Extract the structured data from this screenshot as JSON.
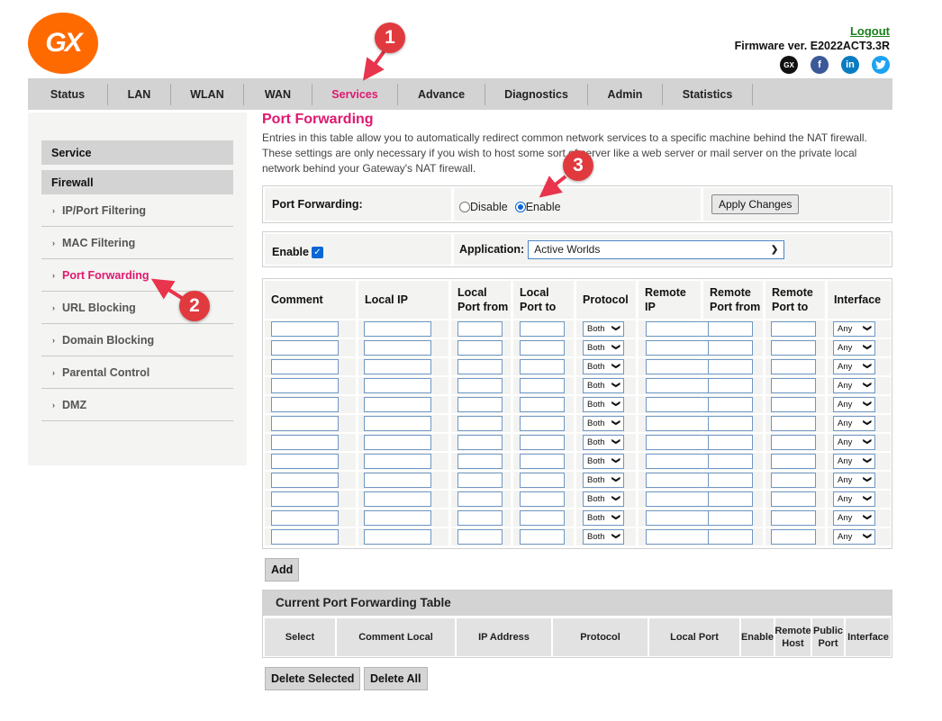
{
  "header": {
    "logo_text": "GX",
    "logout_label": "Logout",
    "firmware": "Firmware ver. E2022ACT3.3R",
    "social": [
      {
        "name": "gx-social-icon",
        "glyph": "GX"
      },
      {
        "name": "facebook-icon",
        "glyph": "f"
      },
      {
        "name": "linkedin-icon",
        "glyph": "in"
      },
      {
        "name": "twitter-icon",
        "glyph": "🐦"
      }
    ]
  },
  "nav": {
    "items": [
      {
        "label": "Status"
      },
      {
        "label": "LAN"
      },
      {
        "label": "WLAN"
      },
      {
        "label": "WAN"
      },
      {
        "label": "Services",
        "active": true
      },
      {
        "label": "Advance"
      },
      {
        "label": "Diagnostics"
      },
      {
        "label": "Admin"
      },
      {
        "label": "Statistics"
      }
    ]
  },
  "sidebar": {
    "sections": [
      "Service",
      "Firewall"
    ],
    "items": [
      {
        "label": "IP/Port Filtering"
      },
      {
        "label": "MAC Filtering"
      },
      {
        "label": "Port Forwarding",
        "active": true
      },
      {
        "label": "URL Blocking"
      },
      {
        "label": "Domain Blocking"
      },
      {
        "label": "Parental Control"
      },
      {
        "label": "DMZ"
      }
    ]
  },
  "main": {
    "title": "Port Forwarding",
    "description": "Entries in this table allow you to automatically redirect common network services to a specific machine behind the NAT firewall. These settings are only necessary if you wish to host some sort of server like a web server or mail server on the private local network behind your Gateway's NAT firewall.",
    "port_forwarding_label": "Port Forwarding:",
    "disable_label": "Disable",
    "enable_label": "Enable",
    "port_forwarding_state": "Enable",
    "apply_label": "Apply Changes",
    "enable_checkbox_label": "Enable",
    "enable_checked": true,
    "application_label": "Application:",
    "application_value": "Active Worlds"
  },
  "rules_table": {
    "headers": [
      "Comment",
      "Local IP",
      "Local\nPort from",
      "Local\nPort to",
      "Protocol",
      "Remote\nIP",
      "Remote\nPort from",
      "Remote\nPort to",
      "Interface"
    ],
    "row_count": 12,
    "protocol_default": "Both",
    "interface_default": "Any"
  },
  "add_label": "Add",
  "current_table": {
    "title": "Current Port Forwarding Table",
    "headers": [
      "Select",
      "Comment Local",
      "IP Address",
      "Protocol",
      "Local Port",
      "Enable",
      "Remote Host",
      "Public Port",
      "Interface"
    ]
  },
  "delete_selected_label": "Delete Selected",
  "delete_all_label": "Delete All",
  "annotations": [
    "1",
    "2",
    "3"
  ],
  "colors": {
    "accent": "#e0186f",
    "logo": "#ff6a00",
    "marker": "#e03a3f",
    "logout": "#1a7f1a"
  }
}
